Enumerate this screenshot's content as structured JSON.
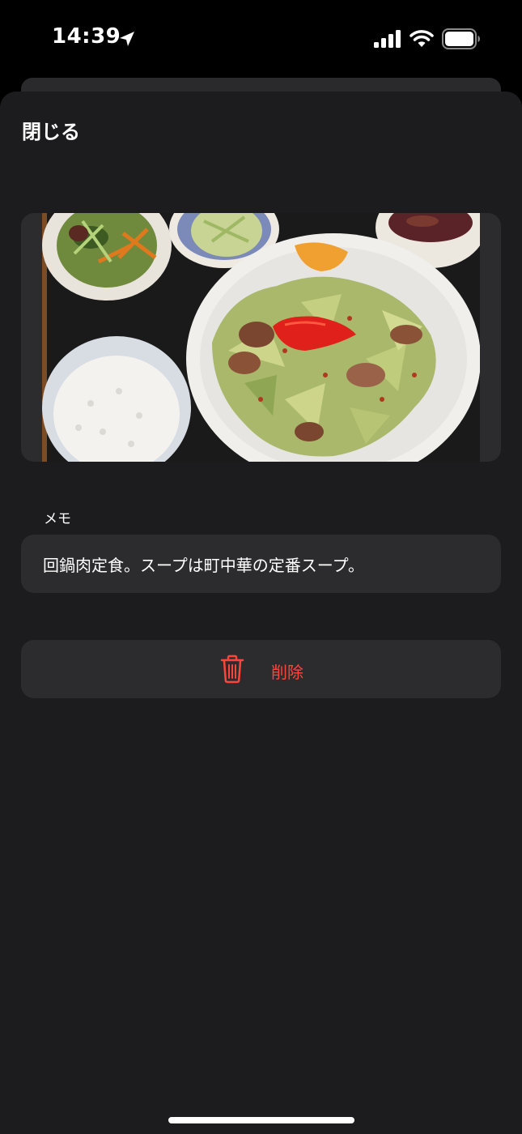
{
  "status_bar": {
    "time": "14:39",
    "icons": [
      "location-arrow-icon",
      "cellular-signal-icon",
      "wifi-icon",
      "battery-icon"
    ]
  },
  "sheet": {
    "close_label": "閉じる",
    "photo": {
      "subject": "food-photo"
    },
    "memo": {
      "label": "メモ",
      "value": "回鍋肉定食。スープは町中華の定番スープ。"
    },
    "delete": {
      "icon": "trash-icon",
      "label": "削除"
    }
  },
  "colors": {
    "background": "#000000",
    "sheet": "#1c1c1e",
    "card": "#2c2c2e",
    "text": "#ffffff",
    "destructive": "#ff453a"
  }
}
